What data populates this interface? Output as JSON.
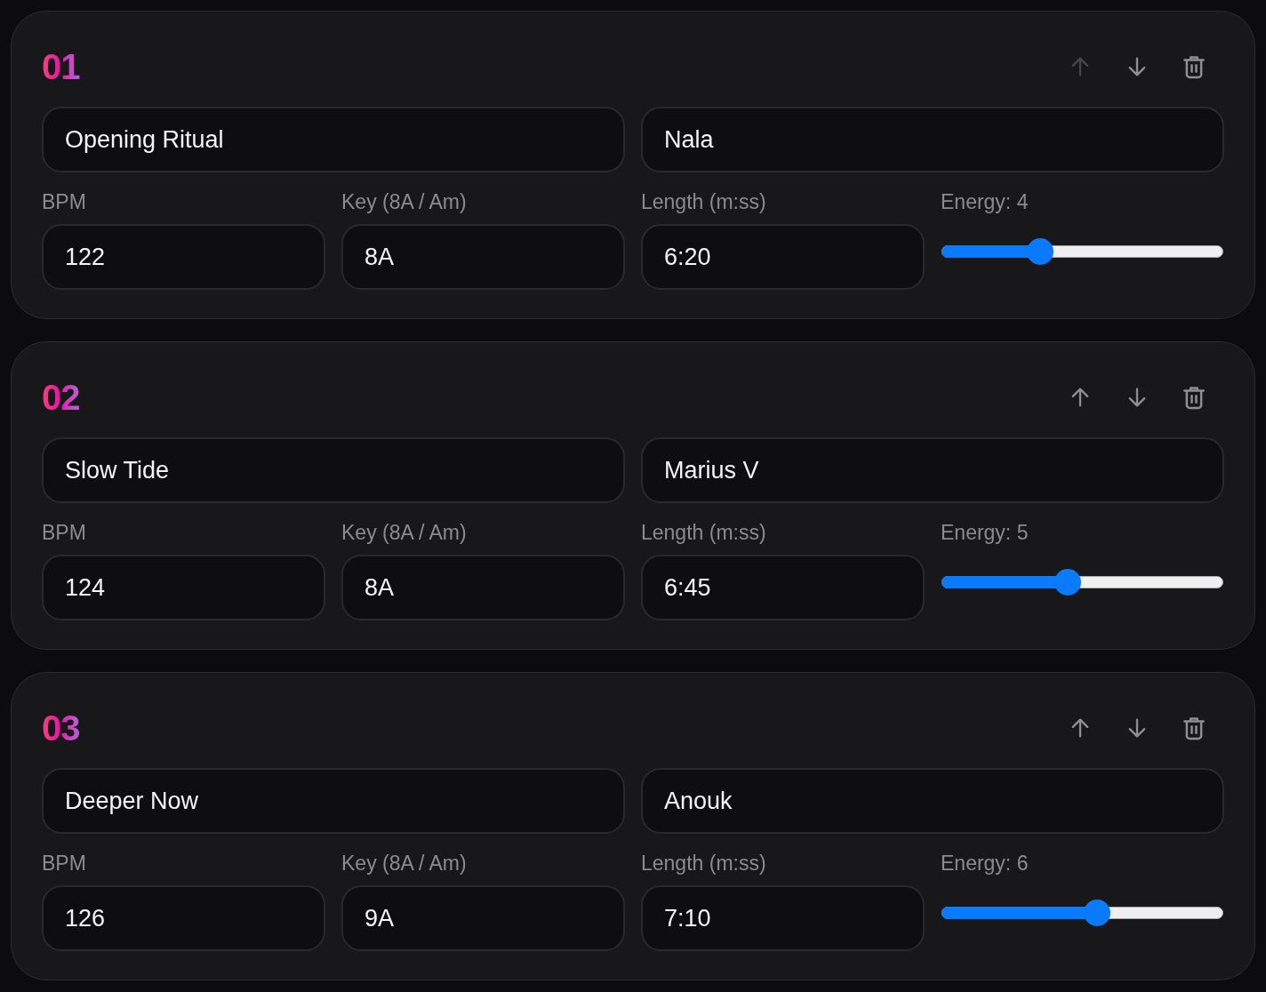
{
  "tracks": [
    {
      "number": "01",
      "title": "Opening Ritual",
      "artist": "Nala",
      "up_disabled": true,
      "down_disabled": false,
      "fields": [
        {
          "label": "BPM",
          "value": "122"
        },
        {
          "label": "Key (8A / Am)",
          "value": "8A"
        },
        {
          "label": "Length (m:ss)",
          "value": "6:20"
        }
      ],
      "energy": {
        "label": "Energy: 4",
        "level": 0.333
      }
    },
    {
      "number": "02",
      "title": "Slow Tide",
      "artist": "Marius V",
      "up_disabled": false,
      "down_disabled": false,
      "fields": [
        {
          "label": "BPM",
          "value": "124"
        },
        {
          "label": "Key (8A / Am)",
          "value": "8A"
        },
        {
          "label": "Length (m:ss)",
          "value": "6:45"
        }
      ],
      "energy": {
        "label": "Energy: 5",
        "level": 0.444
      }
    },
    {
      "number": "03",
      "title": "Deeper Now",
      "artist": "Anouk",
      "up_disabled": false,
      "down_disabled": false,
      "fields": [
        {
          "label": "BPM",
          "value": "126"
        },
        {
          "label": "Key (8A / Am)",
          "value": "9A"
        },
        {
          "label": "Length (m:ss)",
          "value": "7:10"
        }
      ],
      "energy": {
        "label": "Energy: 6",
        "level": 0.556
      }
    }
  ]
}
